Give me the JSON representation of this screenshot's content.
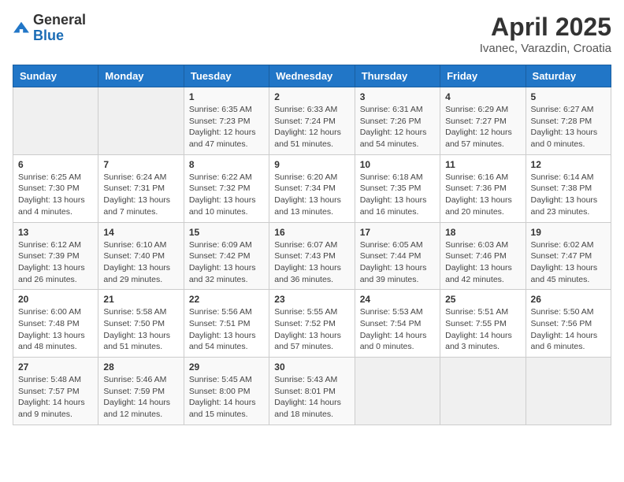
{
  "logo": {
    "general": "General",
    "blue": "Blue"
  },
  "header": {
    "title": "April 2025",
    "subtitle": "Ivanec, Varazdin, Croatia"
  },
  "weekdays": [
    "Sunday",
    "Monday",
    "Tuesday",
    "Wednesday",
    "Thursday",
    "Friday",
    "Saturday"
  ],
  "weeks": [
    [
      {
        "day": "",
        "info": ""
      },
      {
        "day": "",
        "info": ""
      },
      {
        "day": "1",
        "info": "Sunrise: 6:35 AM\nSunset: 7:23 PM\nDaylight: 12 hours and 47 minutes."
      },
      {
        "day": "2",
        "info": "Sunrise: 6:33 AM\nSunset: 7:24 PM\nDaylight: 12 hours and 51 minutes."
      },
      {
        "day": "3",
        "info": "Sunrise: 6:31 AM\nSunset: 7:26 PM\nDaylight: 12 hours and 54 minutes."
      },
      {
        "day": "4",
        "info": "Sunrise: 6:29 AM\nSunset: 7:27 PM\nDaylight: 12 hours and 57 minutes."
      },
      {
        "day": "5",
        "info": "Sunrise: 6:27 AM\nSunset: 7:28 PM\nDaylight: 13 hours and 0 minutes."
      }
    ],
    [
      {
        "day": "6",
        "info": "Sunrise: 6:25 AM\nSunset: 7:30 PM\nDaylight: 13 hours and 4 minutes."
      },
      {
        "day": "7",
        "info": "Sunrise: 6:24 AM\nSunset: 7:31 PM\nDaylight: 13 hours and 7 minutes."
      },
      {
        "day": "8",
        "info": "Sunrise: 6:22 AM\nSunset: 7:32 PM\nDaylight: 13 hours and 10 minutes."
      },
      {
        "day": "9",
        "info": "Sunrise: 6:20 AM\nSunset: 7:34 PM\nDaylight: 13 hours and 13 minutes."
      },
      {
        "day": "10",
        "info": "Sunrise: 6:18 AM\nSunset: 7:35 PM\nDaylight: 13 hours and 16 minutes."
      },
      {
        "day": "11",
        "info": "Sunrise: 6:16 AM\nSunset: 7:36 PM\nDaylight: 13 hours and 20 minutes."
      },
      {
        "day": "12",
        "info": "Sunrise: 6:14 AM\nSunset: 7:38 PM\nDaylight: 13 hours and 23 minutes."
      }
    ],
    [
      {
        "day": "13",
        "info": "Sunrise: 6:12 AM\nSunset: 7:39 PM\nDaylight: 13 hours and 26 minutes."
      },
      {
        "day": "14",
        "info": "Sunrise: 6:10 AM\nSunset: 7:40 PM\nDaylight: 13 hours and 29 minutes."
      },
      {
        "day": "15",
        "info": "Sunrise: 6:09 AM\nSunset: 7:42 PM\nDaylight: 13 hours and 32 minutes."
      },
      {
        "day": "16",
        "info": "Sunrise: 6:07 AM\nSunset: 7:43 PM\nDaylight: 13 hours and 36 minutes."
      },
      {
        "day": "17",
        "info": "Sunrise: 6:05 AM\nSunset: 7:44 PM\nDaylight: 13 hours and 39 minutes."
      },
      {
        "day": "18",
        "info": "Sunrise: 6:03 AM\nSunset: 7:46 PM\nDaylight: 13 hours and 42 minutes."
      },
      {
        "day": "19",
        "info": "Sunrise: 6:02 AM\nSunset: 7:47 PM\nDaylight: 13 hours and 45 minutes."
      }
    ],
    [
      {
        "day": "20",
        "info": "Sunrise: 6:00 AM\nSunset: 7:48 PM\nDaylight: 13 hours and 48 minutes."
      },
      {
        "day": "21",
        "info": "Sunrise: 5:58 AM\nSunset: 7:50 PM\nDaylight: 13 hours and 51 minutes."
      },
      {
        "day": "22",
        "info": "Sunrise: 5:56 AM\nSunset: 7:51 PM\nDaylight: 13 hours and 54 minutes."
      },
      {
        "day": "23",
        "info": "Sunrise: 5:55 AM\nSunset: 7:52 PM\nDaylight: 13 hours and 57 minutes."
      },
      {
        "day": "24",
        "info": "Sunrise: 5:53 AM\nSunset: 7:54 PM\nDaylight: 14 hours and 0 minutes."
      },
      {
        "day": "25",
        "info": "Sunrise: 5:51 AM\nSunset: 7:55 PM\nDaylight: 14 hours and 3 minutes."
      },
      {
        "day": "26",
        "info": "Sunrise: 5:50 AM\nSunset: 7:56 PM\nDaylight: 14 hours and 6 minutes."
      }
    ],
    [
      {
        "day": "27",
        "info": "Sunrise: 5:48 AM\nSunset: 7:57 PM\nDaylight: 14 hours and 9 minutes."
      },
      {
        "day": "28",
        "info": "Sunrise: 5:46 AM\nSunset: 7:59 PM\nDaylight: 14 hours and 12 minutes."
      },
      {
        "day": "29",
        "info": "Sunrise: 5:45 AM\nSunset: 8:00 PM\nDaylight: 14 hours and 15 minutes."
      },
      {
        "day": "30",
        "info": "Sunrise: 5:43 AM\nSunset: 8:01 PM\nDaylight: 14 hours and 18 minutes."
      },
      {
        "day": "",
        "info": ""
      },
      {
        "day": "",
        "info": ""
      },
      {
        "day": "",
        "info": ""
      }
    ]
  ]
}
